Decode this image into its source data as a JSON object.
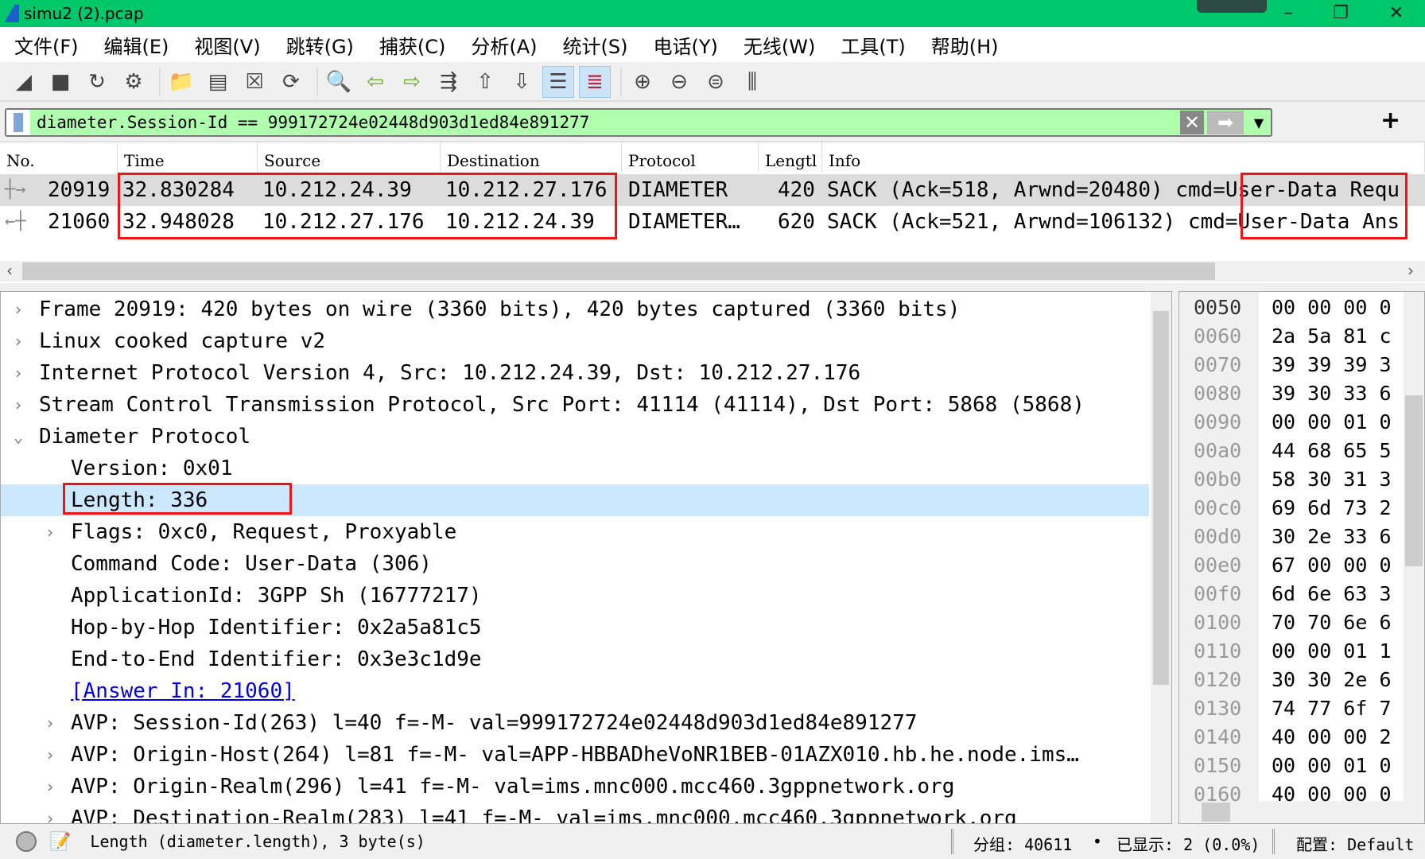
{
  "window": {
    "title": "simu2 (2).pcap",
    "minimize": "–",
    "restore": "❐",
    "close": "✕"
  },
  "menu": [
    "文件(F)",
    "编辑(E)",
    "视图(V)",
    "跳转(G)",
    "捕获(C)",
    "分析(A)",
    "统计(S)",
    "电话(Y)",
    "无线(W)",
    "工具(T)",
    "帮助(H)"
  ],
  "toolbar": {
    "icons": [
      "start-capture-icon",
      "stop-capture-icon",
      "restart-capture-icon",
      "capture-options-icon",
      "open-file-icon",
      "save-file-icon",
      "close-file-icon",
      "reload-file-icon",
      "find-packet-icon",
      "go-back-icon",
      "go-forward-icon",
      "go-to-packet-icon",
      "go-first-icon",
      "go-last-icon",
      "auto-scroll-icon",
      "colorize-icon",
      "zoom-in-icon",
      "zoom-out-icon",
      "normal-size-icon",
      "resize-columns-icon"
    ]
  },
  "filter": {
    "value": "diameter.Session-Id == 999172724e02448d903d1ed84e891277",
    "add": "+"
  },
  "packet_list": {
    "columns": [
      "No.",
      "Time",
      "Source",
      "Destination",
      "Protocol",
      "Lengtl",
      "Info"
    ],
    "rows": [
      {
        "no": "20919",
        "time": "32.830284",
        "src": "10.212.24.39",
        "dst": "10.212.27.176",
        "proto": "DIAMETER",
        "len": "420",
        "info": "SACK (Ack=518, Arwnd=20480) cmd=User-Data Requ"
      },
      {
        "no": "21060",
        "time": "32.948028",
        "src": "10.212.27.176",
        "dst": "10.212.24.39",
        "proto": "DIAMETER…",
        "len": "620",
        "info": "SACK (Ack=521, Arwnd=106132) cmd=User-Data Ans"
      }
    ]
  },
  "details": [
    {
      "text": "Frame 20919: 420 bytes on wire (3360 bits), 420 bytes captured (3360 bits)",
      "arrow": "›",
      "indent": 0
    },
    {
      "text": "Linux cooked capture v2",
      "arrow": "›",
      "indent": 0
    },
    {
      "text": "Internet Protocol Version 4, Src: 10.212.24.39, Dst: 10.212.27.176",
      "arrow": "›",
      "indent": 0
    },
    {
      "text": "Stream Control Transmission Protocol, Src Port: 41114 (41114), Dst Port: 5868 (5868)",
      "arrow": "›",
      "indent": 0
    },
    {
      "text": "Diameter Protocol",
      "arrow": "⌄",
      "indent": 0
    },
    {
      "text": "Version: 0x01",
      "arrow": "",
      "indent": 1
    },
    {
      "text": "Length: 336",
      "arrow": "",
      "indent": 1,
      "selected": true
    },
    {
      "text": "Flags: 0xc0, Request, Proxyable",
      "arrow": "›",
      "indent": 1
    },
    {
      "text": "Command Code: User-Data (306)",
      "arrow": "",
      "indent": 1
    },
    {
      "text": "ApplicationId: 3GPP Sh (16777217)",
      "arrow": "",
      "indent": 1
    },
    {
      "text": "Hop-by-Hop Identifier: 0x2a5a81c5",
      "arrow": "",
      "indent": 1
    },
    {
      "text": "End-to-End Identifier: 0x3e3c1d9e",
      "arrow": "",
      "indent": 1
    },
    {
      "text": "[Answer In: 21060]",
      "arrow": "",
      "indent": 1,
      "link": true
    },
    {
      "text": "AVP: Session-Id(263) l=40 f=-M- val=999172724e02448d903d1ed84e891277",
      "arrow": "›",
      "indent": 1
    },
    {
      "text": "AVP: Origin-Host(264) l=81 f=-M- val=APP-HBBADheVoNR1BEB-01AZX010.hb.he.node.ims…",
      "arrow": "›",
      "indent": 1
    },
    {
      "text": "AVP: Origin-Realm(296) l=41 f=-M- val=ims.mnc000.mcc460.3gppnetwork.org",
      "arrow": "›",
      "indent": 1
    },
    {
      "text": "AVP: Destination-Realm(283) l=41 f=-M- val=ims.mnc000.mcc460.3gppnetwork.org",
      "arrow": "›",
      "indent": 1
    }
  ],
  "hex": [
    [
      "0050",
      "00 00 00 0"
    ],
    [
      "0060",
      "2a 5a 81 c"
    ],
    [
      "0070",
      "39 39 39 3"
    ],
    [
      "0080",
      "39 30 33 6"
    ],
    [
      "0090",
      "00 00 01 0"
    ],
    [
      "00a0",
      "44 68 65 5"
    ],
    [
      "00b0",
      "58 30 31 3"
    ],
    [
      "00c0",
      "69 6d 73 2"
    ],
    [
      "00d0",
      "30 2e 33 6"
    ],
    [
      "00e0",
      "67 00 00 0"
    ],
    [
      "00f0",
      "6d 6e 63 3"
    ],
    [
      "0100",
      "70 70 6e 6"
    ],
    [
      "0110",
      "00 00 01 1"
    ],
    [
      "0120",
      "30 30 2e 6"
    ],
    [
      "0130",
      "74 77 6f 7"
    ],
    [
      "0140",
      "40 00 00 2"
    ],
    [
      "0150",
      "00 00 01 0"
    ],
    [
      "0160",
      "40 00 00 0"
    ]
  ],
  "status": {
    "field": "Length (diameter.length), 3 byte(s)",
    "packets": "分组: 40611",
    "displayed": "已显示: 2 (0.0%)",
    "profile": "配置: Default"
  },
  "colors": {
    "titlebar": "#00c86a",
    "filter_ok": "#afffaf",
    "highlight": "#f01414",
    "selected": "#cce8ff"
  }
}
